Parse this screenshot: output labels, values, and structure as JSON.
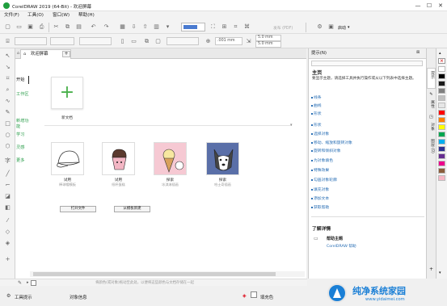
{
  "window": {
    "title": "CorelDRAW 2019 (64-Bit) - 欢迎屏幕",
    "minimize": "—",
    "maximize": "☐",
    "close": "✕"
  },
  "menu": [
    "文件(F)",
    "工具(O)",
    "窗口(W)",
    "帮助(H)"
  ],
  "toolbar": {
    "publish_label": "发布 (PDF)",
    "launch_label": "启动",
    "launch_dropdown": "▾"
  },
  "propertybar": {
    "nudge": ".001 mm",
    "w": "5.0 mm",
    "h": "5.0 mm"
  },
  "tabs": {
    "welcome": "欢迎屏幕",
    "add": "+"
  },
  "leftnav": [
    "开始",
    "工作区",
    "新增功能",
    "学习",
    "灵感",
    "更多"
  ],
  "start": {
    "new_doc": "新文档",
    "new_icon": "+",
    "templates": [
      {
        "title": "试用",
        "subtitle": "棒球帽模板"
      },
      {
        "title": "试用",
        "subtitle": "纸杯蛋糕"
      },
      {
        "title": "探索",
        "subtitle": "冰淇淋插画"
      },
      {
        "title": "探索",
        "subtitle": "哈士奇插画"
      }
    ],
    "open_file": "打开文件",
    "from_template": "从模板新建"
  },
  "hints": {
    "panel_title": "提示(N)",
    "heading": "主页",
    "intro": "要显示主题，请选择工具并执行操作或从以下列表中选择主题。",
    "topics": [
      "线条",
      "曲线",
      "形状",
      "形状",
      "选择对象",
      "移动、缩放和旋转对象",
      "旋转和倾斜对象",
      "为对象填色",
      "特殊效果",
      "勾画对象轮廓",
      "填充对象",
      "添加文本",
      "获取帮助"
    ],
    "learn_more": "了解详情",
    "help_topics": "帮助主题",
    "help_sub": "CorelDRAW 帮助"
  },
  "dockers": [
    "提示",
    "属性",
    "对象",
    "图层 (0)"
  ],
  "status": {
    "hint_text": "将颜色(或对象)拖动至此处，以便将这些颜色与文档存储在一起",
    "tool_hint": "工具提示",
    "object_info": "对象信息",
    "fill_color": "填充色",
    "watermark": "纯净系统家园",
    "watermark_url": "www.yidaimei.com"
  },
  "palette_colors": [
    "#ffffff",
    "#000000",
    "#1a1a1a",
    "#7f7f7f",
    "#c0c0c0",
    "#e6e6e6",
    "#ff0000",
    "#ff7f00",
    "#ffff00",
    "#00a650",
    "#00aeef",
    "#2e3192",
    "#662d91",
    "#ec008c",
    "#8b5e3c",
    "#f7b7c5"
  ]
}
